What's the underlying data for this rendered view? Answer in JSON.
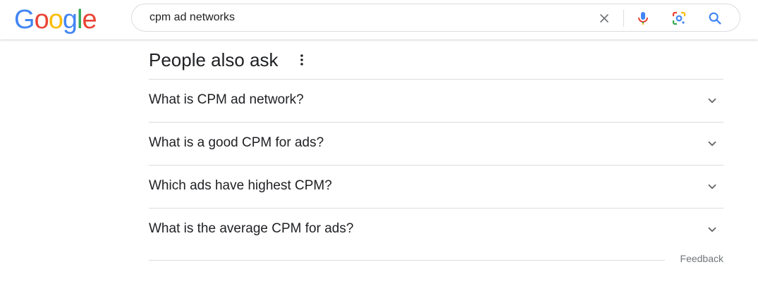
{
  "logo": {
    "letters": [
      "G",
      "o",
      "o",
      "g",
      "l",
      "e"
    ],
    "colors": [
      "#4285F4",
      "#EA4335",
      "#FBBC05",
      "#4285F4",
      "#34A853",
      "#EA4335"
    ]
  },
  "search": {
    "query": "cpm ad networks",
    "icons": [
      "clear-icon",
      "microphone-icon",
      "lens-icon",
      "search-icon"
    ]
  },
  "paa": {
    "title": "People also ask",
    "menu_icon": "more-vert-icon",
    "questions": [
      {
        "text": "What is CPM ad network?"
      },
      {
        "text": "What is a good CPM for ads?"
      },
      {
        "text": "Which ads have highest CPM?"
      },
      {
        "text": "What is the average CPM for ads?"
      }
    ],
    "feedback": "Feedback"
  },
  "colors": {
    "text": "#202124",
    "muted": "#70757a",
    "divider": "#dadce0",
    "blue": "#4285F4",
    "red": "#EA4335",
    "yellow": "#FBBC05",
    "green": "#34A853"
  }
}
